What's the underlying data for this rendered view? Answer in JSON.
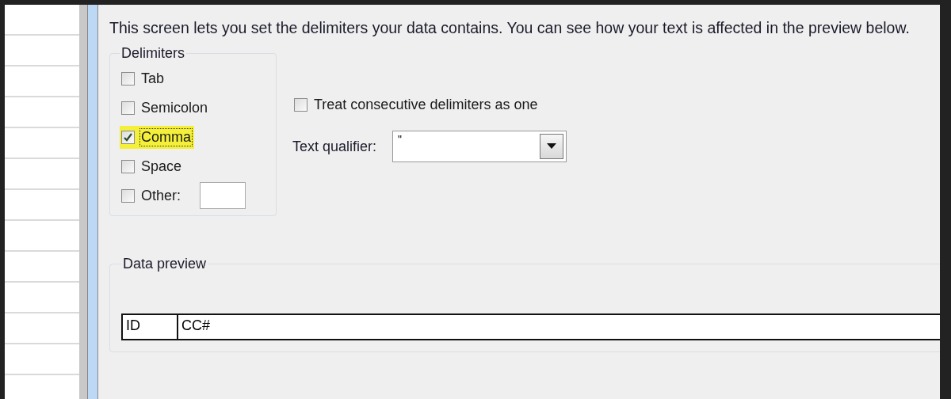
{
  "intro": "This screen lets you set the delimiters your data contains.  You can see how your text is affected in the preview below.",
  "delimiters": {
    "title": "Delimiters",
    "options": [
      {
        "kind": "check",
        "label": "Tab",
        "checked": false,
        "highlighted": false
      },
      {
        "kind": "check",
        "label": "Semicolon",
        "checked": false,
        "highlighted": false
      },
      {
        "kind": "check",
        "label": "Comma",
        "checked": true,
        "highlighted": true
      },
      {
        "kind": "check",
        "label": "Space",
        "checked": false,
        "highlighted": false
      },
      {
        "kind": "other",
        "label": "Other:",
        "checked": false,
        "highlighted": false
      }
    ]
  },
  "consecutive": {
    "label": "Treat consecutive delimiters as one",
    "checked": false
  },
  "qualifier": {
    "label": "Text qualifier:",
    "value": "\""
  },
  "preview": {
    "title": "Data preview",
    "columns": [
      "ID",
      "CC#"
    ]
  }
}
